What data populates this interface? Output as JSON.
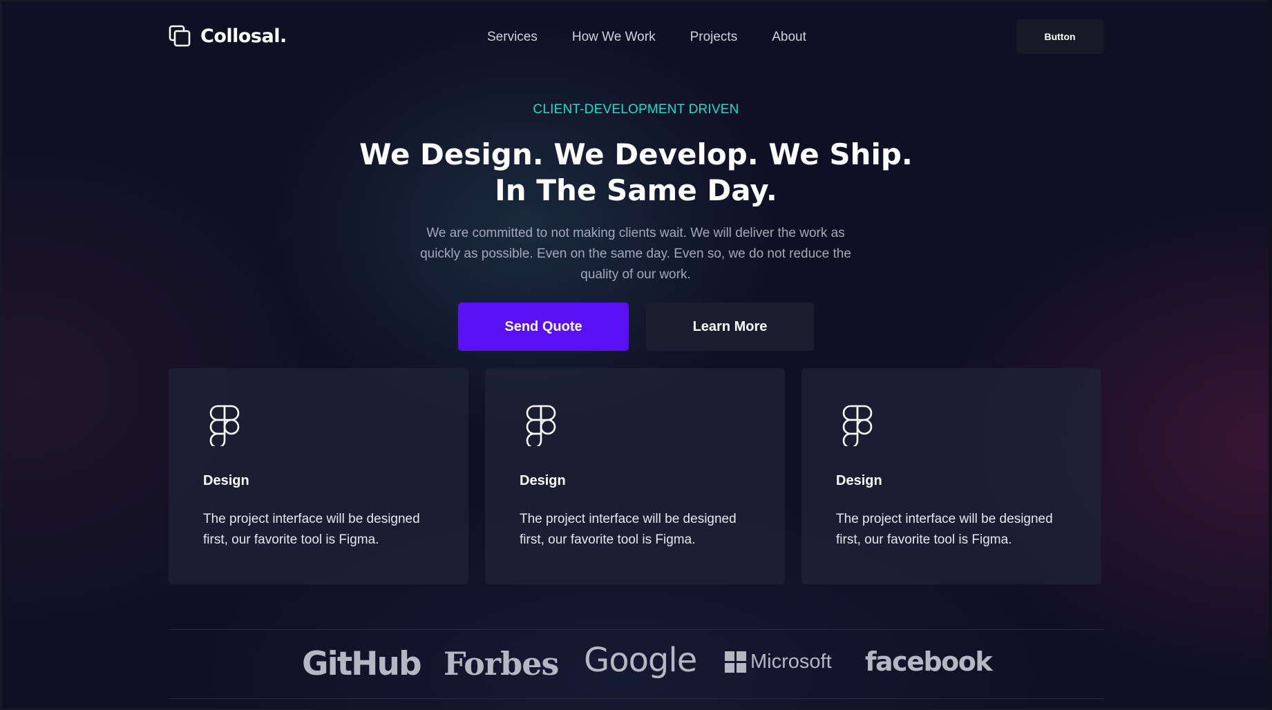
{
  "brand": {
    "name": "Collosal.",
    "icon": "overlapping-squares-icon"
  },
  "nav": {
    "items": [
      {
        "label": "Services"
      },
      {
        "label": "How We Work"
      },
      {
        "label": "Projects"
      },
      {
        "label": "About"
      }
    ],
    "cta_label": "Button"
  },
  "hero": {
    "eyebrow": "CLIENT-DEVELOPMENT DRIVEN",
    "title_line1": "We Design. We Develop. We Ship.",
    "title_line2": "In The Same Day.",
    "description": "We are committed to not making clients wait. We will deliver the work as quickly as possible. Even on the same day. Even so, we do not reduce the quality of our work.",
    "primary_button": "Send Quote",
    "secondary_button": "Learn More"
  },
  "features": [
    {
      "icon": "figma-icon",
      "title": "Design",
      "text": "The project interface will be designed first, our favorite tool is Figma."
    },
    {
      "icon": "figma-icon",
      "title": "Design",
      "text": "The project interface will be designed first, our favorite tool is Figma."
    },
    {
      "icon": "figma-icon",
      "title": "Design",
      "text": "The project interface will be designed first, our favorite tool is Figma."
    }
  ],
  "partners": [
    "GitHub",
    "Forbes",
    "Google",
    "Microsoft",
    "facebook"
  ],
  "colors": {
    "background": "#0f1024",
    "accent_teal": "#14e3c7",
    "primary_purple": "#5a10f5",
    "card_bg": "#1e2438",
    "muted_text": "#a4a9b6",
    "logo_gray": "#b5b8c2"
  }
}
